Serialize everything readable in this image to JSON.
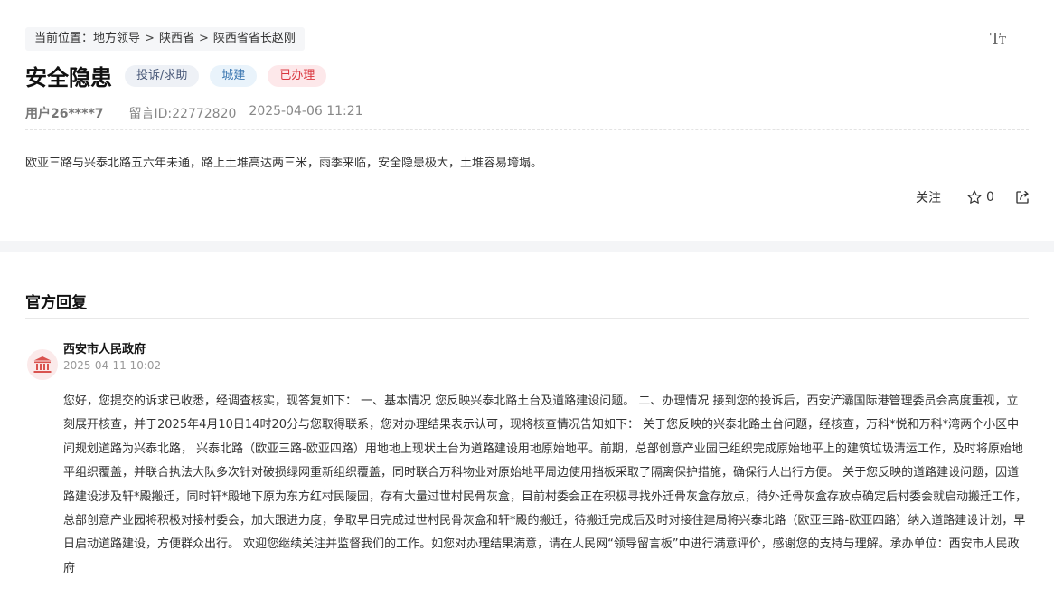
{
  "breadcrumb": {
    "prefix": "当前位置：",
    "items": [
      "地方领导",
      "陕西省",
      "陕西省省长赵刚"
    ],
    "separator": ">"
  },
  "toolbar": {
    "font_size_icon": "font-size-icon"
  },
  "post": {
    "title": "安全隐患",
    "tags": {
      "type": "投诉/求助",
      "category": "城建",
      "status": "已办理"
    },
    "user": "用户26****7",
    "message_id": "留言ID:22772820",
    "time": "2025-04-06 11:21",
    "content": "欧亚三路与兴泰北路五六年未通，路上土堆高达两三米，雨季来临，安全隐患极大，土堆容易垮塌。",
    "actions": {
      "follow": "关注",
      "star_count": "0",
      "star_icon": "star-icon",
      "share_icon": "share-icon"
    }
  },
  "official_reply": {
    "section_title": "官方回复",
    "org_icon": "government-building-icon",
    "org_name": "西安市人民政府",
    "time": "2025-04-11 10:02",
    "text": "您好，您提交的诉求已收悉，经调查核实，现答复如下： 一、基本情况 您反映兴泰北路土台及道路建设问题。 二、办理情况 接到您的投诉后，西安浐灞国际港管理委员会高度重视，立刻展开核查，并于2025年4月10日14时20分与您取得联系，您对办理结果表示认可，现将核查情况告知如下： 关于您反映的兴泰北路土台问题，经核查，万科*悦和万科*湾两个小区中间规划道路为兴泰北路， 兴泰北路（欧亚三路-欧亚四路）用地地上现状土台为道路建设用地原始地平。前期，总部创意产业园已组织完成原始地平上的建筑垃圾清运工作，及时将原始地平组织覆盖，并联合执法大队多次针对破损绿网重新组织覆盖，同时联合万科物业对原始地平周边使用挡板采取了隔离保护措施，确保行人出行方便。 关于您反映的道路建设问题，因道路建设涉及轩*殿搬迁，同时轩*殿地下原为东方红村民陵园，存有大量过世村民骨灰盒，目前村委会正在积极寻找外迁骨灰盒存放点，待外迁骨灰盒存放点确定后村委会就启动搬迁工作，总部创意产业园将积极对接村委会，加大跟进力度，争取早日完成过世村民骨灰盒和轩*殿的搬迁，待搬迁完成后及时对接住建局将兴泰北路（欧亚三路-欧亚四路）纳入道路建设计划，早日启动道路建设，方便群众出行。 欢迎您继续关注并监督我们的工作。如您对办理结果满意，请在人民网“领导留言板”中进行满意评价，感谢您的支持与理解。承办单位：西安市人民政府"
  }
}
